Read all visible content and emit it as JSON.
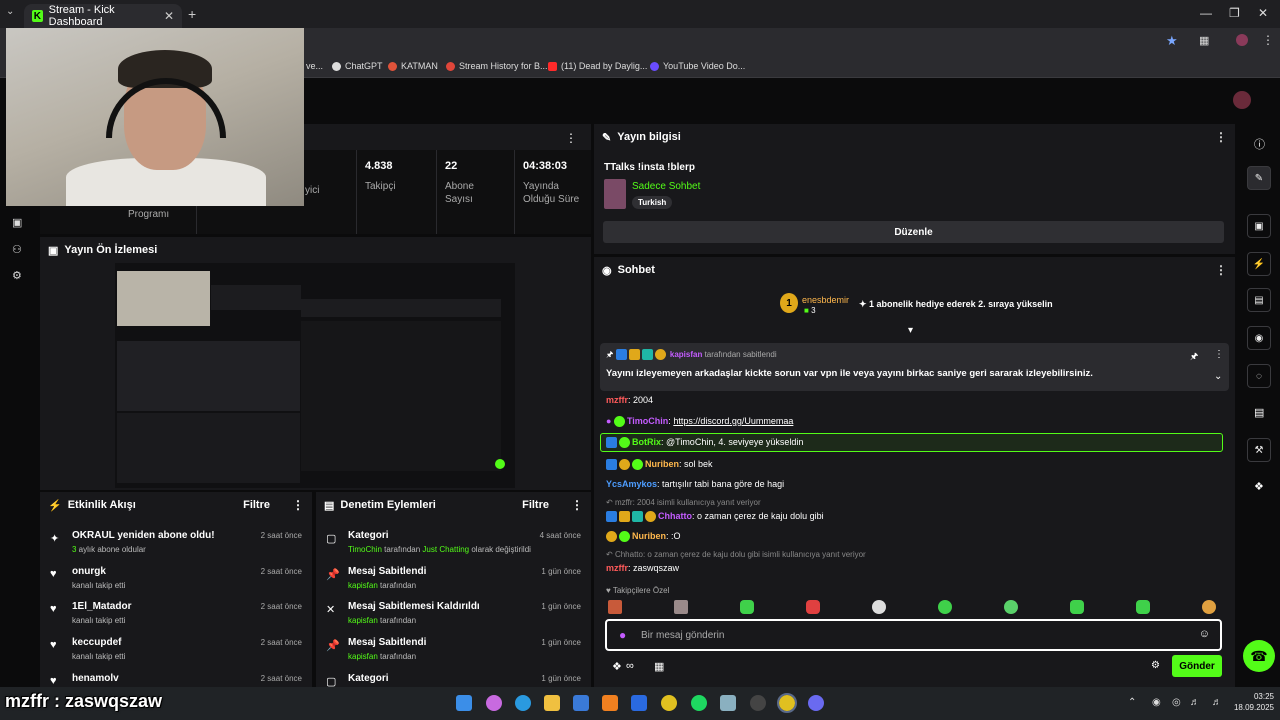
{
  "browser": {
    "tab_title": "Stream - Kick Dashboard",
    "bookmarks": [
      {
        "label": "ve...",
        "color": "#888888"
      },
      {
        "label": "ChatGPT",
        "color": "#dddddd"
      },
      {
        "label": "KATMAN",
        "color": "#e0533a"
      },
      {
        "label": "Stream History for B...",
        "color": "#e0463a"
      },
      {
        "label": "(11) Dead by Daylig...",
        "color": "#ff2a2a"
      },
      {
        "label": "YouTube Video Do...",
        "color": "#6a4cff"
      }
    ]
  },
  "stats": [
    {
      "value": "",
      "label": "yici"
    },
    {
      "value": "4.838",
      "label": "Takipçi"
    },
    {
      "value": "22",
      "label": "Abone Sayısı"
    },
    {
      "value": "04:38:03",
      "label": "Yayında Olduğu Süre"
    }
  ],
  "stats_partial_label": "Programı",
  "preview": {
    "title": "Yayın Ön İzlemesi"
  },
  "activity": {
    "title": "Etkinlik Akışı",
    "filter": "Filtre",
    "items": [
      {
        "title": "OKRAUL yeniden abone oldu!",
        "sub_pre": "3",
        "sub": " aylık abone oldular",
        "time": "2 saat önce",
        "icon": "sparkle-icon"
      },
      {
        "title": "onurgk",
        "sub_pre": "",
        "sub": "kanalı takip etti",
        "time": "2 saat önce",
        "icon": "heart-icon"
      },
      {
        "title": "1El_Matador",
        "sub_pre": "",
        "sub": "kanalı takip etti",
        "time": "2 saat önce",
        "icon": "heart-icon"
      },
      {
        "title": "keccupdef",
        "sub_pre": "",
        "sub": "kanalı takip etti",
        "time": "2 saat önce",
        "icon": "heart-icon"
      },
      {
        "title": "henamolv",
        "sub_pre": "",
        "sub": "",
        "time": "2 saat önce",
        "icon": "heart-icon"
      }
    ]
  },
  "moderation": {
    "title": "Denetim Eylemleri",
    "filter": "Filtre",
    "items": [
      {
        "title": "Kategori",
        "sub_user": "TimoChin",
        "sub_mid": " tarafından ",
        "sub_cat": "Just Chatting",
        "sub_end": " olarak değiştirildi",
        "time": "4 saat önce"
      },
      {
        "title": "Mesaj Sabitlendi",
        "sub_user": "kapisfan",
        "sub_mid": " tarafından",
        "sub_cat": "",
        "sub_end": "",
        "time": "1 gün önce"
      },
      {
        "title": "Mesaj Sabitlemesi Kaldırıldı",
        "sub_user": "kapisfan",
        "sub_mid": " tarafından",
        "sub_cat": "",
        "sub_end": "",
        "time": "1 gün önce"
      },
      {
        "title": "Mesaj Sabitlendi",
        "sub_user": "kapisfan",
        "sub_mid": " tarafından",
        "sub_cat": "",
        "sub_end": "",
        "time": "1 gün önce"
      },
      {
        "title": "Kategori",
        "sub_user": "",
        "sub_mid": "",
        "sub_cat": "",
        "sub_end": "",
        "time": "1 gün önce"
      }
    ]
  },
  "stream_info": {
    "title": "Yayın bilgisi",
    "stream_title": "TTalks !insta !blerp",
    "category": "Sadece Sohbet",
    "language": "Turkish",
    "edit_button": "Düzenle"
  },
  "chat": {
    "title": "Sohbet",
    "gift_user": "enesbdemir",
    "gift_count": "3",
    "gift_text": "1 abonelik hediye ederek 2. sıraya yükselin",
    "pinned_by_user": "kapisfan",
    "pinned_by_text": "tarafından sabitlendi",
    "pinned_message": "Yayını izleyemeyen arkadaşlar kickte sorun var vpn ile veya yayını birkac saniye geri sararak izleyebilirsiniz.",
    "messages": [
      {
        "user": "mzffr",
        "color": "#ff5a5a",
        "text": "2004"
      },
      {
        "user": "TimoChin",
        "color": "#c45cff",
        "text": "https://discord.gg/Uummemaa",
        "link": true
      },
      {
        "user": "BotRix",
        "color": "#53fc18",
        "text": "@TimoChin, 4. seviyeye yükseldin",
        "highlight": true
      },
      {
        "user": "Nuriben",
        "color": "#ffb84d",
        "text": "sol bek"
      },
      {
        "user": "YcsAmykos",
        "color": "#4d9dff",
        "text": "tartışılır tabi bana göre de hagi"
      },
      {
        "user": "Chhatto",
        "color": "#c45cff",
        "text": "o zaman çerez de kaju dolu gibi",
        "reply": "mzffr: 2004 isimli kullanıcıya yanıt veriyor"
      },
      {
        "user": "Nuriben",
        "color": "#ffb84d",
        "text": ":O"
      },
      {
        "user": "mzffr",
        "color": "#ff5a5a",
        "text": "zaswqszaw",
        "reply": "Chhatto: o zaman çerez de kaju dolu gibi isimli kullanıcıya yanıt veriyor"
      }
    ],
    "emote_section": "Takipçilere Özel",
    "input_placeholder": "Bir mesaj gönderin",
    "send_button": "Gönder"
  },
  "overlay_text": "mzffr : zaswqszaw",
  "clock": {
    "time": "03:25",
    "date": "18.09.2025"
  }
}
